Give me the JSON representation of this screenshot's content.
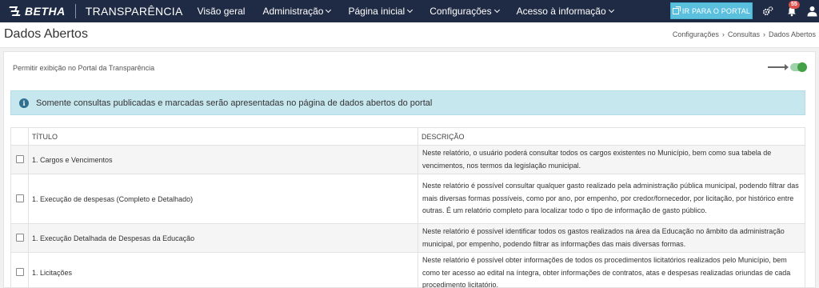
{
  "topbar": {
    "brand": "BETHA",
    "product": "TRANSPARÊNCIA",
    "nav": [
      {
        "label": "Visão geral",
        "has_dropdown": false
      },
      {
        "label": "Administração",
        "has_dropdown": true
      },
      {
        "label": "Página inicial",
        "has_dropdown": true
      },
      {
        "label": "Configurações",
        "has_dropdown": true
      },
      {
        "label": "Acesso à informação",
        "has_dropdown": true
      }
    ],
    "portal_button": "IR PARA O PORTAL",
    "notifications_count": "55",
    "colors": {
      "bar": "#1f2a44",
      "portal_button": "#5bc0de",
      "badge": "#d9534f"
    }
  },
  "header": {
    "title": "Dados Abertos",
    "breadcrumb": [
      "Configurações",
      "Consultas",
      "Dados Abertos"
    ]
  },
  "settings": {
    "permit_label": "Permitir exibição no Portal da Transparência",
    "toggle_on": true,
    "toggle_color": "#43a047"
  },
  "alert": {
    "icon": "info-icon",
    "text": "Somente consultas publicadas e marcadas serão apresentadas no página de dados abertos do portal"
  },
  "table": {
    "columns": [
      "TÍTULO",
      "DESCRIÇÃO"
    ],
    "rows": [
      {
        "checked": false,
        "title": "1. Cargos e Vencimentos",
        "description": "Neste relatório, o usuário poderá consultar todos os cargos existentes no Município, bem como sua tabela de vencimentos, nos termos da legislação municipal."
      },
      {
        "checked": false,
        "title": "1. Execução de despesas (Completo e Detalhado)",
        "description": "Neste relatório é possível consultar qualquer gasto realizado pela administração pública municipal, podendo filtrar das mais diversas formas possíveis, como por ano, por empenho, por credor/fornecedor, por licitação, por histórico entre outras. É um relatório completo para localizar todo o tipo de informação de gasto público."
      },
      {
        "checked": false,
        "title": "1. Execução Detalhada de Despesas da Educação",
        "description": "Neste relatório é possível identificar todos os gastos realizados na área da Educação no âmbito da administração municipal, por empenho, podendo filtrar as informações das mais diversas formas."
      },
      {
        "checked": false,
        "title": "1. Licitações",
        "description": "Neste relatório é possível obter informações de todos os procedimentos licitatórios realizados pelo Município, bem como ter acesso ao edital na íntegra, obter informações de contratos, atas e despesas realizadas oriundas de cada procedimento licitatório."
      }
    ]
  }
}
